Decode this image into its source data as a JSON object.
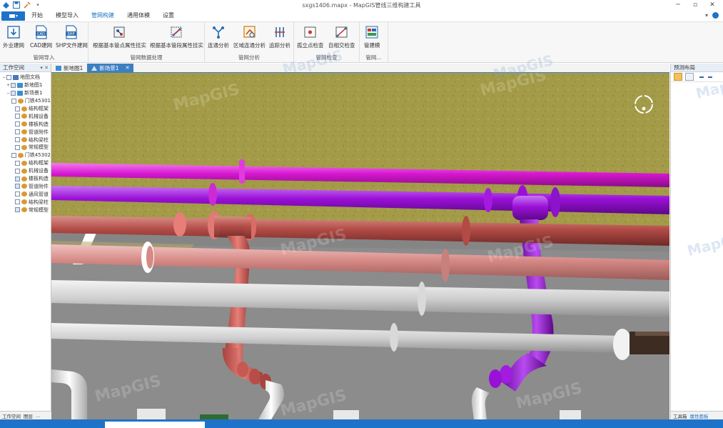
{
  "window": {
    "title": "sxgs1406.mapx - MapGIS管线三维构建工具",
    "controls": [
      "─",
      "▫",
      "✕"
    ]
  },
  "menu": {
    "file_label": "",
    "tabs": [
      "开始",
      "模型导入",
      "管网构建",
      "通用体模",
      "设置"
    ],
    "active_tab": "管网构建"
  },
  "ribbon": {
    "groups": [
      {
        "label": "管网导入",
        "buttons": [
          "外业建网",
          "CAD建网",
          "SHP文件建网"
        ]
      },
      {
        "label": "管网数据处理",
        "buttons": [
          "根据基本管点属性挂实",
          "根据基本管段属性挂实"
        ]
      },
      {
        "label": "管网分析",
        "buttons": [
          "连通分析",
          "区域连通分析",
          "追踪分析"
        ]
      },
      {
        "label": "管网检查",
        "buttons": [
          "孤立点检查",
          "自相交检查"
        ]
      },
      {
        "label": "管网...",
        "buttons": [
          "管建模"
        ]
      }
    ]
  },
  "workspace": {
    "title": "工作空间",
    "pin": "▾ ✕",
    "tree": [
      {
        "level": 0,
        "label": "地图文档",
        "icon": "doc",
        "expand": "−",
        "check": false
      },
      {
        "level": 1,
        "label": "新地图1",
        "icon": "map",
        "expand": "+",
        "check": true
      },
      {
        "level": 1,
        "label": "新场景1",
        "icon": "map",
        "expand": "−",
        "check": true
      },
      {
        "level": 2,
        "label": "门铁45301",
        "icon": "layer",
        "check": false
      },
      {
        "level": 2,
        "label": "结构框架",
        "icon": "layer",
        "check": false
      },
      {
        "level": 2,
        "label": "机械设备",
        "icon": "layer",
        "check": false
      },
      {
        "level": 2,
        "label": "楼板构造",
        "icon": "layer",
        "check": false
      },
      {
        "level": 2,
        "label": "管道附件",
        "icon": "layer",
        "check": false
      },
      {
        "level": 2,
        "label": "结构梁柱",
        "icon": "layer",
        "check": false
      },
      {
        "level": 2,
        "label": "常规模型",
        "icon": "layer",
        "check": false
      },
      {
        "level": 2,
        "label": "门铁45302",
        "icon": "layer",
        "check": false
      },
      {
        "level": 2,
        "label": "结构框架",
        "icon": "layer",
        "check": false
      },
      {
        "level": 2,
        "label": "机械设备",
        "icon": "layer",
        "check": false
      },
      {
        "level": 2,
        "label": "楼板构造",
        "icon": "layer",
        "check": true
      },
      {
        "level": 2,
        "label": "管道附件",
        "icon": "layer",
        "check": true
      },
      {
        "level": 2,
        "label": "通风管道",
        "icon": "layer",
        "check": false
      },
      {
        "level": 2,
        "label": "结构梁柱",
        "icon": "layer",
        "check": false
      },
      {
        "level": 2,
        "label": "常规模型",
        "icon": "layer",
        "check": true
      }
    ],
    "bottom_tabs": [
      "工作空间",
      "图层",
      "..."
    ]
  },
  "document_tabs": [
    {
      "label": "新地图1",
      "active": false
    },
    {
      "label": "新场景1",
      "active": true,
      "close": "✕"
    }
  ],
  "right_panel": {
    "title": "预测布局",
    "bottom_tabs": [
      "工具箱",
      "属性面板"
    ]
  },
  "watermark": "MapGIS",
  "colors": {
    "accent": "#1e73c8",
    "ground": "#a39b48",
    "floor": "#8c8c8c",
    "pipe_magenta": "#d617d0",
    "pipe_purple": "#9b10d8",
    "pipe_red": "#b24b46",
    "pipe_pink": "#d68a86",
    "pipe_gray": "#cfcfcf"
  }
}
